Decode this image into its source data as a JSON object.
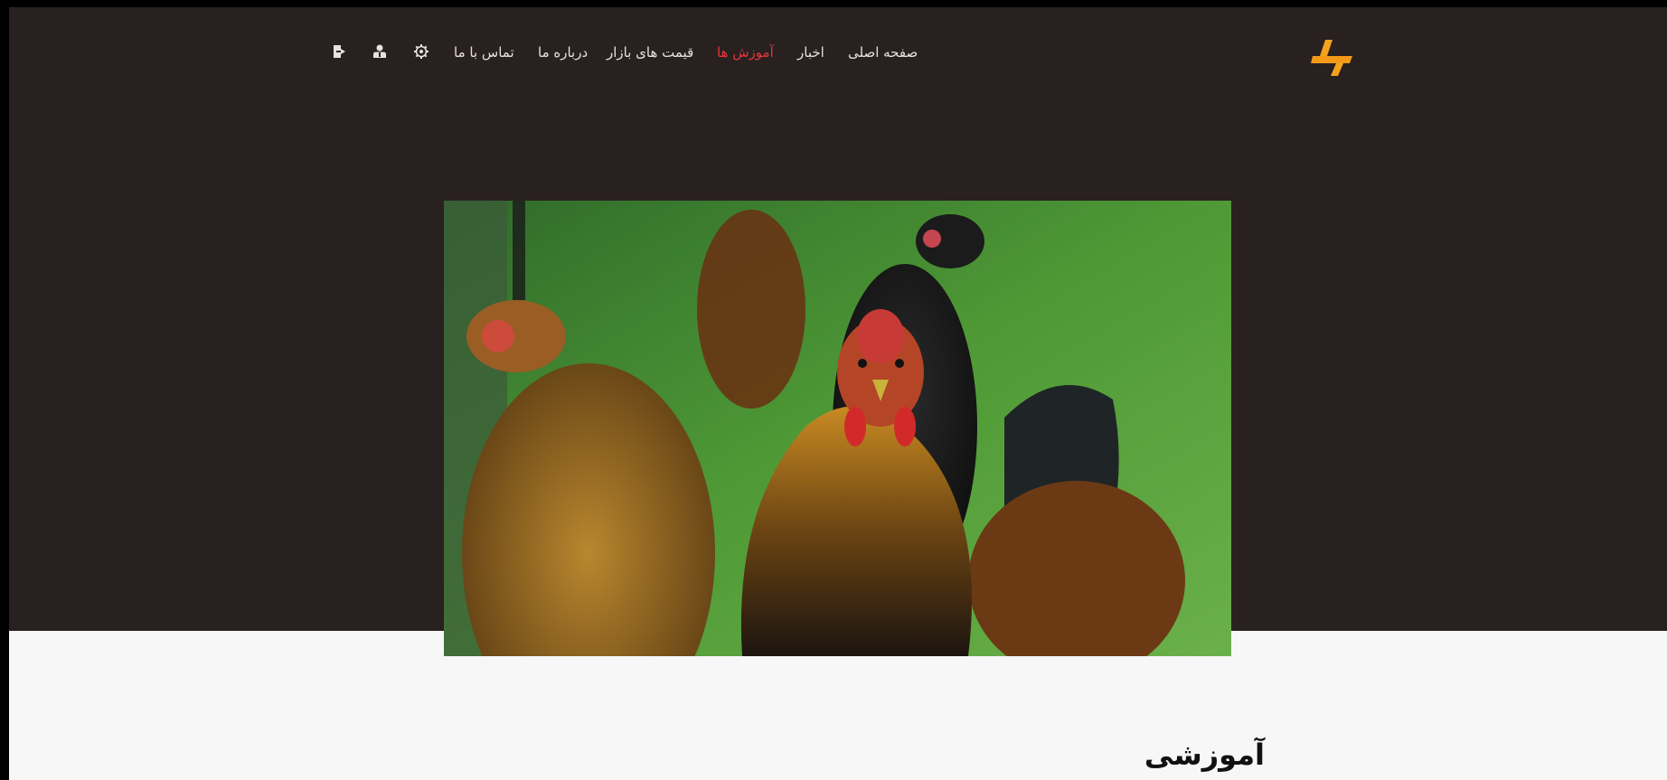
{
  "nav": {
    "home": "صفحه اصلی",
    "news": "اخبار",
    "tutorials": "آموزش ها",
    "market_prices": "قیمت های بازار",
    "about": "درباره ما",
    "contact": "تماس با ما",
    "active_item": "tutorials",
    "icons": [
      "settings-icon",
      "user-icon",
      "logout-icon"
    ]
  },
  "hero": {
    "image_subject": "chickens"
  },
  "section": {
    "title": "آموزشی"
  },
  "colors": {
    "header_bg": "#292020",
    "page_bg": "#f7f7f7",
    "nav_text": "#e8e2de",
    "nav_active": "#e8353a",
    "logo": "#f4a21c"
  }
}
